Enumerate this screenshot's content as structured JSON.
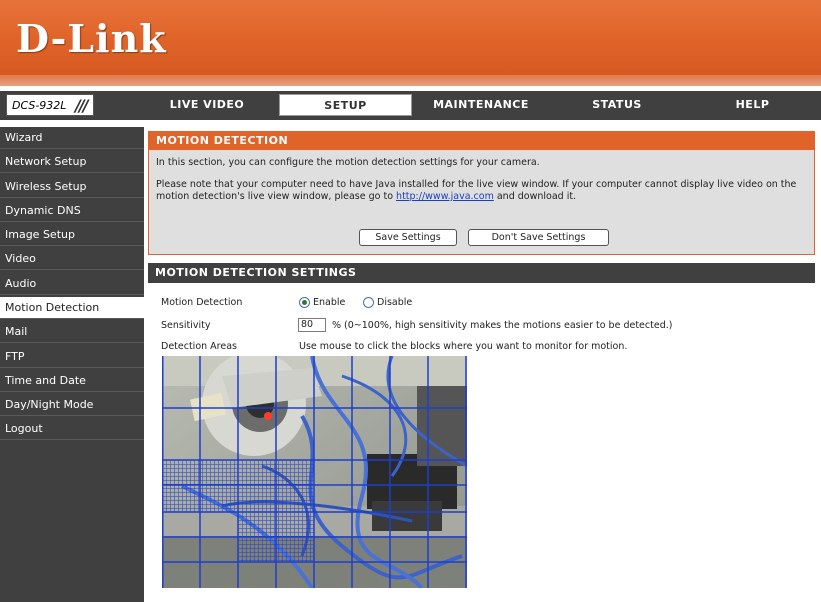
{
  "brand": {
    "logo": "D-Link"
  },
  "model": {
    "name": "DCS-932L"
  },
  "nav": {
    "tabs": [
      "LIVE VIDEO",
      "SETUP",
      "MAINTENANCE",
      "STATUS",
      "HELP"
    ],
    "active_tab": "SETUP"
  },
  "sidebar": {
    "items": [
      "Wizard",
      "Network Setup",
      "Wireless Setup",
      "Dynamic DNS",
      "Image Setup",
      "Video",
      "Audio",
      "Motion Detection",
      "Mail",
      "FTP",
      "Time and Date",
      "Day/Night Mode",
      "Logout"
    ],
    "active_item": "Motion Detection"
  },
  "intro": {
    "title": "MOTION DETECTION",
    "p1": "In this section, you can configure the motion detection settings for your camera.",
    "p2_before": "Please note that your computer need to have Java installed for the live view window. If your computer cannot display live video on the motion detection's live view window, please go to ",
    "p2_link": "http://www.java.com",
    "p2_after": " and download it.",
    "save_label": "Save Settings",
    "dont_save_label": "Don't Save Settings"
  },
  "settings": {
    "title": "MOTION DETECTION SETTINGS",
    "motion_label": "Motion Detection",
    "enable_label": "Enable",
    "disable_label": "Disable",
    "motion_value": "Enable",
    "sensitivity_label": "Sensitivity",
    "sensitivity_value": "80",
    "sensitivity_hint": "% (0~100%, high sensitivity makes the motions easier to be detected.)",
    "areas_label": "Detection Areas",
    "areas_hint": "Use mouse to click the blocks where you want to monitor for motion."
  },
  "colors": {
    "brand_orange": "#e0642a",
    "nav_dark": "#404040",
    "grid_blue": "#1f3fc8",
    "link_blue": "#1a3fbf"
  }
}
